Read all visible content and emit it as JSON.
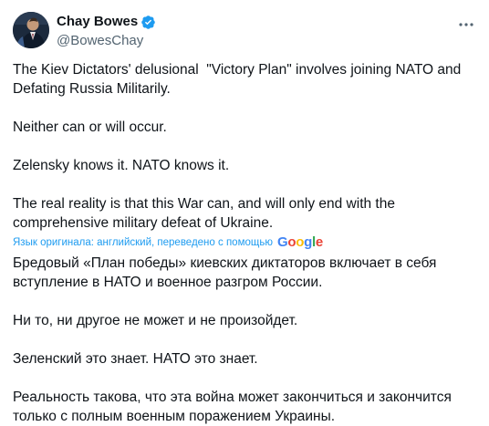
{
  "author": {
    "display_name": "Chay Bowes",
    "handle": "@BowesChay",
    "avatar_icon": "avatar-image",
    "verified_icon": "verified-badge-icon",
    "verified_color": "#1d9bf0"
  },
  "more_icon": "more-dots-icon",
  "tweet": {
    "original_paragraphs": [
      "The Kiev Dictators' delusional  \"Victory Plan\" involves joining NATO and Defating Russia Militarily.",
      "Neither can or will occur.",
      "Zelensky knows it. NATO knows it.",
      "The real reality is that this War can, and will only end with the comprehensive military defeat of Ukraine."
    ],
    "translation_note": "Язык оригинала: английский, переведено с помощью",
    "translation_provider": "Google",
    "translated_paragraphs": [
      "Бредовый «План победы» киевских диктаторов включает в себя вступление в НАТО и военное разгром России.",
      "Ни то, ни другое не может и не произойдет.",
      "Зеленский это знает. НАТО это знает.",
      "Реальность такова, что эта война может закончиться и закончится только с полным военным поражением Украины."
    ]
  },
  "colors": {
    "link": "#1d9bf0",
    "text": "#0f1419",
    "secondary": "#536471"
  }
}
